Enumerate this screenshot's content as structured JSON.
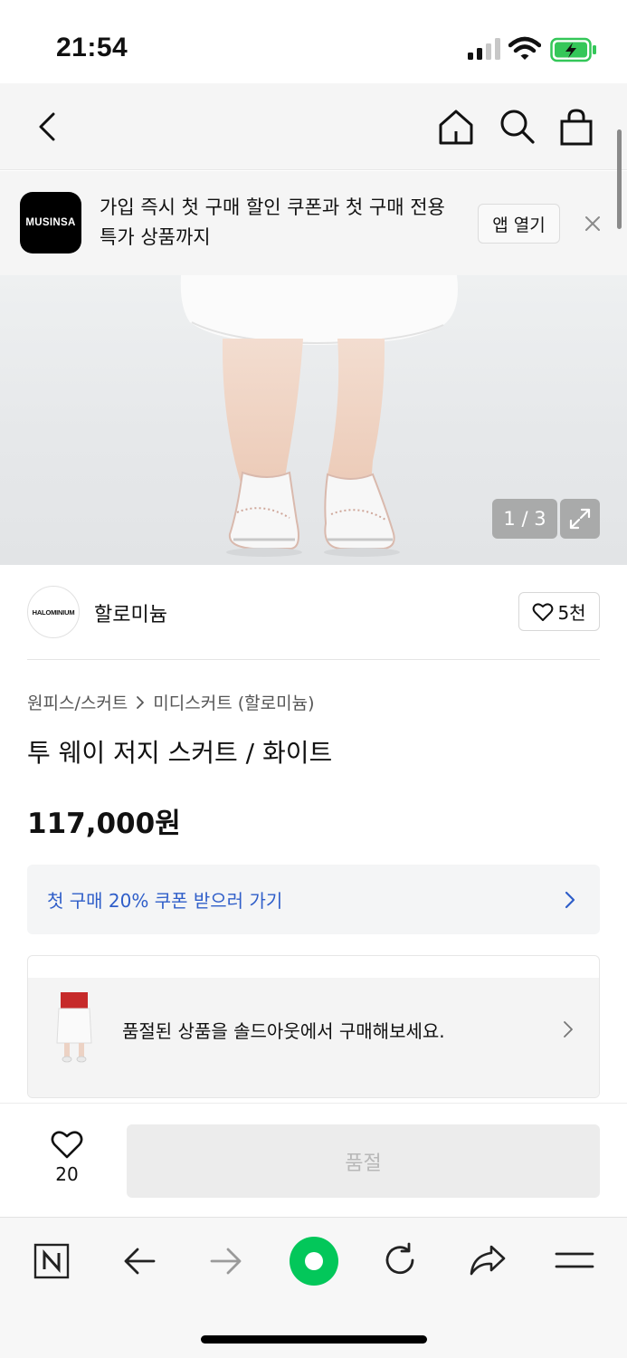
{
  "status_bar": {
    "time": "21:54",
    "icons": [
      "signal-icon",
      "wifi-icon",
      "battery-charging-icon"
    ]
  },
  "nav": {
    "icons": [
      "back-arrow-icon",
      "home-icon",
      "search-icon",
      "shopping-bag-icon"
    ]
  },
  "app_banner": {
    "logo_text": "MUSINSA",
    "message": "가입 즉시 첫 구매 할인 쿠폰과 첫 구매 전용 특가 상품까지",
    "open_app_label": "앱 열기",
    "close_icon": "close-icon"
  },
  "gallery": {
    "counter": "1 / 3",
    "expand_icon": "expand-icon"
  },
  "brand": {
    "logo_text": "HALOMINIUM",
    "name": "할로미늄",
    "like_count": "5천"
  },
  "breadcrumb": {
    "category": "원피스/스커트",
    "subcategory": "미디스커트 (할로미늄)"
  },
  "product": {
    "title": "투 웨이 저지 스커트 / 화이트",
    "price": "117,000원"
  },
  "coupon": {
    "label": "첫 구매 20% 쿠폰 받으러 가기"
  },
  "soldout_notice": {
    "message": "품절된 상품을 솔드아웃에서 구매해보세요."
  },
  "purchase_bar": {
    "wish_count": "20",
    "soldout_label": "품절"
  },
  "browser_toolbar": {
    "icons": [
      "naver-n-icon",
      "back-icon",
      "forward-icon",
      "green-circle-icon",
      "reload-icon",
      "share-icon",
      "menu-icon"
    ]
  },
  "colors": {
    "coupon_text": "#2f5ec9",
    "naver_green": "#03c75a",
    "battery_green": "#34c759"
  }
}
